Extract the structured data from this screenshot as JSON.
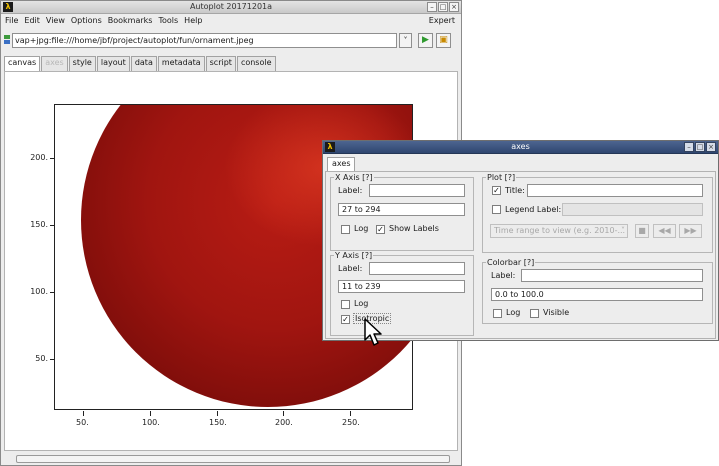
{
  "main_window": {
    "title": "Autoplot 20171201a",
    "app_icon": "autoplot-icon",
    "window_buttons": [
      "–",
      "□",
      "×"
    ],
    "menu": [
      "File",
      "Edit",
      "View",
      "Options",
      "Bookmarks",
      "Tools",
      "Help"
    ],
    "menu_right": "Expert",
    "url": "vap+jpg:file:///home/jbf/project/autoplot/fun/ornament.jpeg",
    "url_dropdown_glyph": "˅",
    "go_glyph": "▶",
    "browse_glyph": "▣",
    "tabs": [
      {
        "label": "canvas",
        "state": "active"
      },
      {
        "label": "axes",
        "state": "disabled"
      },
      {
        "label": "style",
        "state": "normal"
      },
      {
        "label": "layout",
        "state": "normal"
      },
      {
        "label": "data",
        "state": "normal"
      },
      {
        "label": "metadata",
        "state": "normal"
      },
      {
        "label": "script",
        "state": "normal"
      },
      {
        "label": "console",
        "state": "normal"
      }
    ]
  },
  "plot": {
    "x_ticks": [
      "50.",
      "100.",
      "150.",
      "200.",
      "250."
    ],
    "y_ticks": [
      "200.",
      "150.",
      "100.",
      "50."
    ],
    "image_colors": {
      "ornament": "#a01510",
      "highlight": "#f04628"
    }
  },
  "axes_dialog": {
    "title": "axes",
    "tab": "axes",
    "x_axis": {
      "legend": "X Axis [?]",
      "label_caption": "Label:",
      "label_value": "",
      "range": "27 to 294",
      "log_label": "Log",
      "log_checked": false,
      "show_labels_label": "Show Labels",
      "show_labels_checked": true
    },
    "y_axis": {
      "legend": "Y Axis [?]",
      "label_caption": "Label:",
      "label_value": "",
      "range": "11 to 239",
      "log_label": "Log",
      "log_checked": false,
      "isotropic_label": "Isotropic",
      "isotropic_checked": true
    },
    "plot_section": {
      "legend": "Plot [?]",
      "title_caption": "Title:",
      "title_checked": true,
      "title_value": "",
      "legend_label_caption": "Legend Label:",
      "legend_label_checked": false,
      "time_range_placeholder": "Time range to view (e.g. 2010-...",
      "stop_glyph": "■",
      "prev_glyph": "◀◀",
      "next_glyph": "▶▶"
    },
    "colorbar": {
      "legend": "Colorbar [?]",
      "label_caption": "Label:",
      "label_value": "",
      "range": "0.0 to 100.0",
      "log_label": "Log",
      "log_checked": false,
      "visible_label": "Visible",
      "visible_checked": false
    }
  }
}
